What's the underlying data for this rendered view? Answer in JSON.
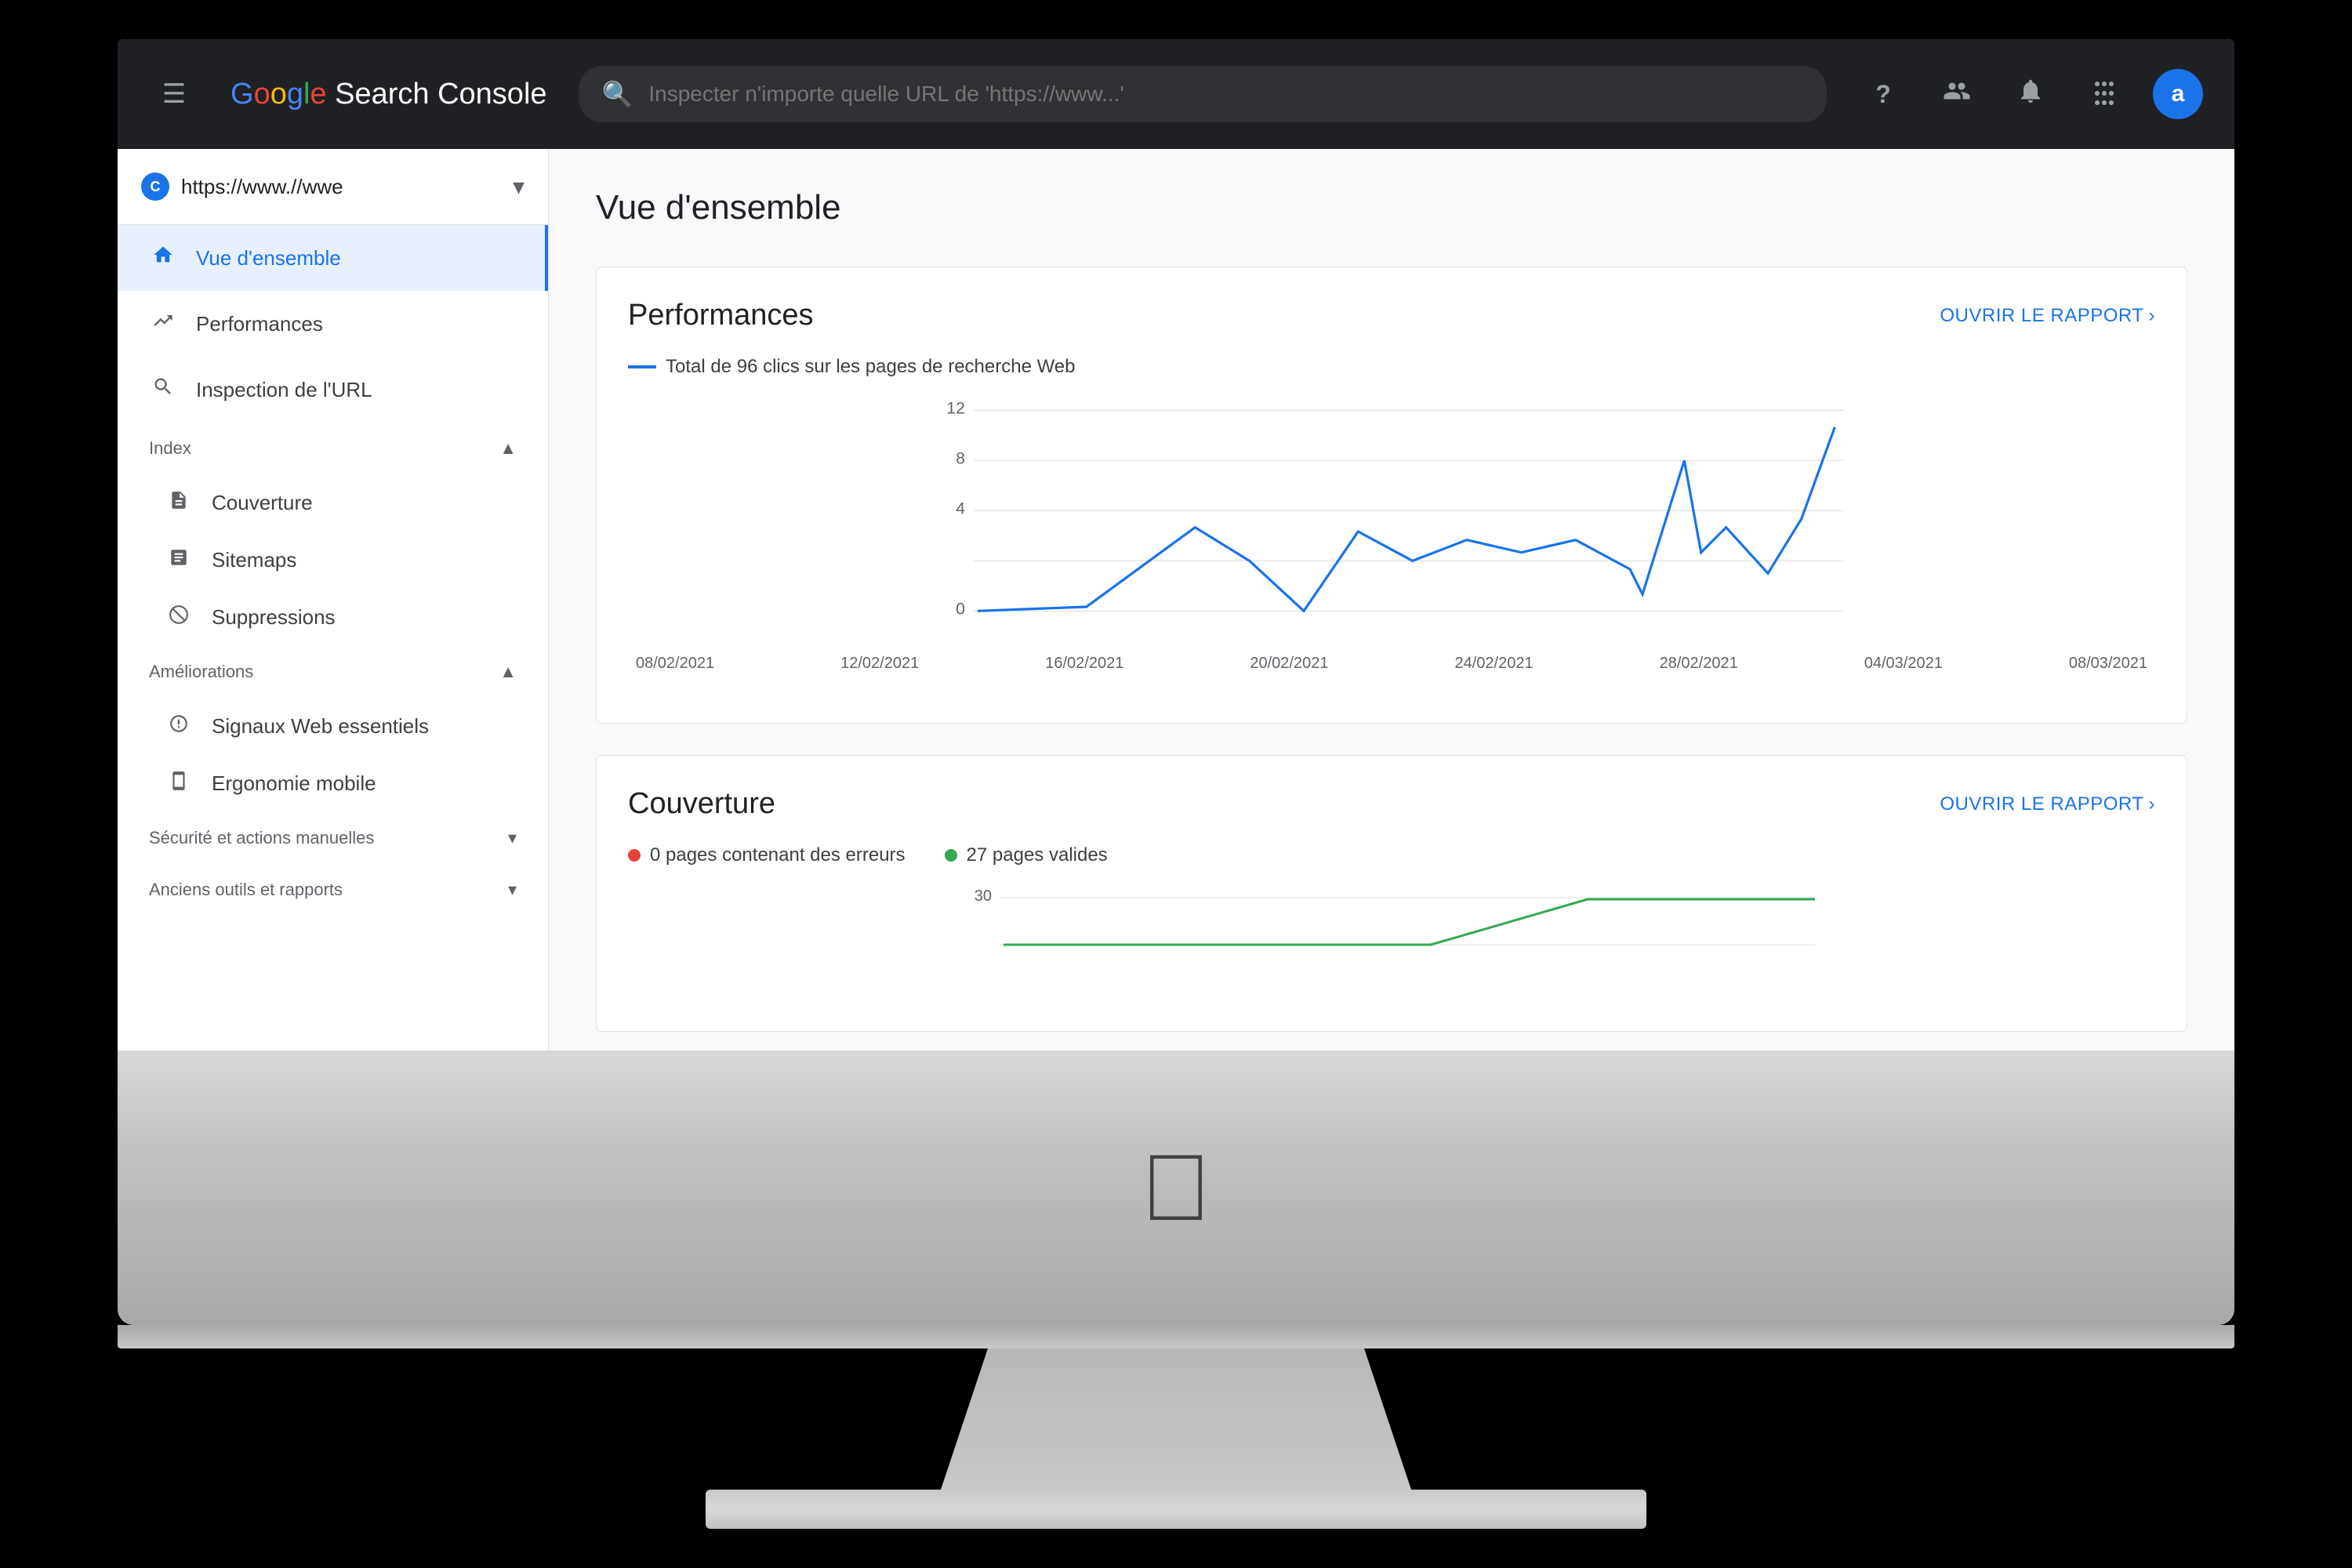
{
  "app": {
    "title": "Google Search Console",
    "logo": {
      "google": "Google",
      "rest": "Search Console"
    }
  },
  "topbar": {
    "search_placeholder": "Inspecter n'importe quelle URL de 'https://www...'",
    "icons": {
      "help": "?",
      "users": "👤",
      "bell": "🔔",
      "grid": "⊞",
      "avatar": "a"
    }
  },
  "sidebar": {
    "site_url": "https://www.//wwe",
    "nav": [
      {
        "id": "vue-ensemble",
        "label": "Vue d'ensemble",
        "icon": "🏠",
        "active": true
      },
      {
        "id": "performances",
        "label": "Performances",
        "icon": "📈",
        "active": false
      },
      {
        "id": "inspection-url",
        "label": "Inspection de l'URL",
        "icon": "🔍",
        "active": false
      }
    ],
    "sections": [
      {
        "id": "index",
        "label": "Index",
        "items": [
          {
            "id": "couverture",
            "label": "Couverture",
            "icon": "📄"
          },
          {
            "id": "sitemaps",
            "label": "Sitemaps",
            "icon": "📋"
          },
          {
            "id": "suppressions",
            "label": "Suppressions",
            "icon": "🚫"
          }
        ]
      },
      {
        "id": "ameliorations",
        "label": "Améliorations",
        "items": [
          {
            "id": "signaux-web",
            "label": "Signaux Web essentiels",
            "icon": "⚡"
          },
          {
            "id": "ergonomie",
            "label": "Ergonomie mobile",
            "icon": "📱"
          }
        ]
      },
      {
        "id": "securite",
        "label": "Sécurité et actions manuelles",
        "items": []
      },
      {
        "id": "anciens-outils",
        "label": "Anciens outils et rapports",
        "items": []
      }
    ]
  },
  "content": {
    "page_title": "Vue d'ensemble",
    "cards": [
      {
        "id": "performances",
        "title": "Performances",
        "link_label": "OUVRIR LE RAPPORT",
        "legend": "Total de 96 clics sur les pages de recherche Web",
        "legend_color": "#1a73e8",
        "chart": {
          "y_labels": [
            "12",
            "8",
            "4",
            "0"
          ],
          "x_labels": [
            "08/02/2021",
            "12/02/2021",
            "16/02/2021",
            "20/02/2021",
            "24/02/2021",
            "28/02/2021",
            "04/03/2021",
            "08/03/2021"
          ],
          "data_color": "#1a73e8"
        }
      },
      {
        "id": "couverture",
        "title": "Couverture",
        "link_label": "OUVRIR LE RAPPORT",
        "legend_errors": "0 pages contenant des erreurs",
        "legend_valid": "27 pages valides",
        "y_start": "30"
      }
    ]
  },
  "monitor": {
    "apple_logo": "",
    "base_visible": true
  }
}
